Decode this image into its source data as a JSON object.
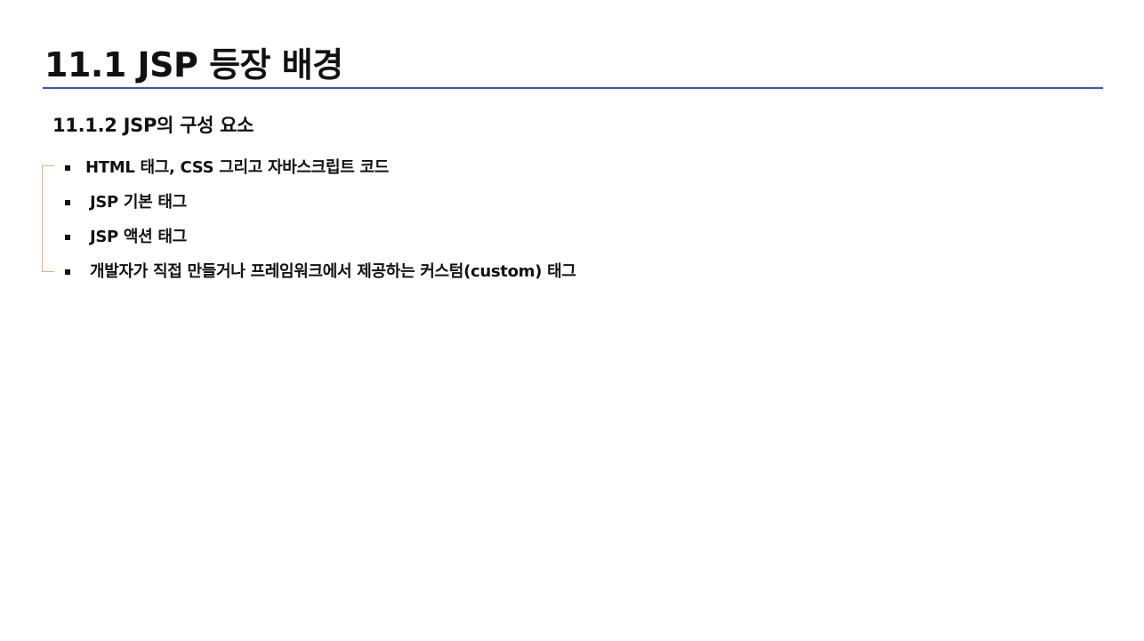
{
  "slide": {
    "title": "11.1 JSP 등장 배경",
    "subtitle": "11.1.2 JSP의 구성 요소",
    "bullets": [
      "HTML 태그, CSS 그리고 자바스크립트 코드",
      "JSP 기본 태그",
      "JSP 액션 태그",
      "개발자가 직접 만들거나 프레임워크에서 제공하는 커스텀(custom) 태그"
    ],
    "accent_color": "#3b4fd8",
    "bracket_color": "#e2b27a"
  }
}
